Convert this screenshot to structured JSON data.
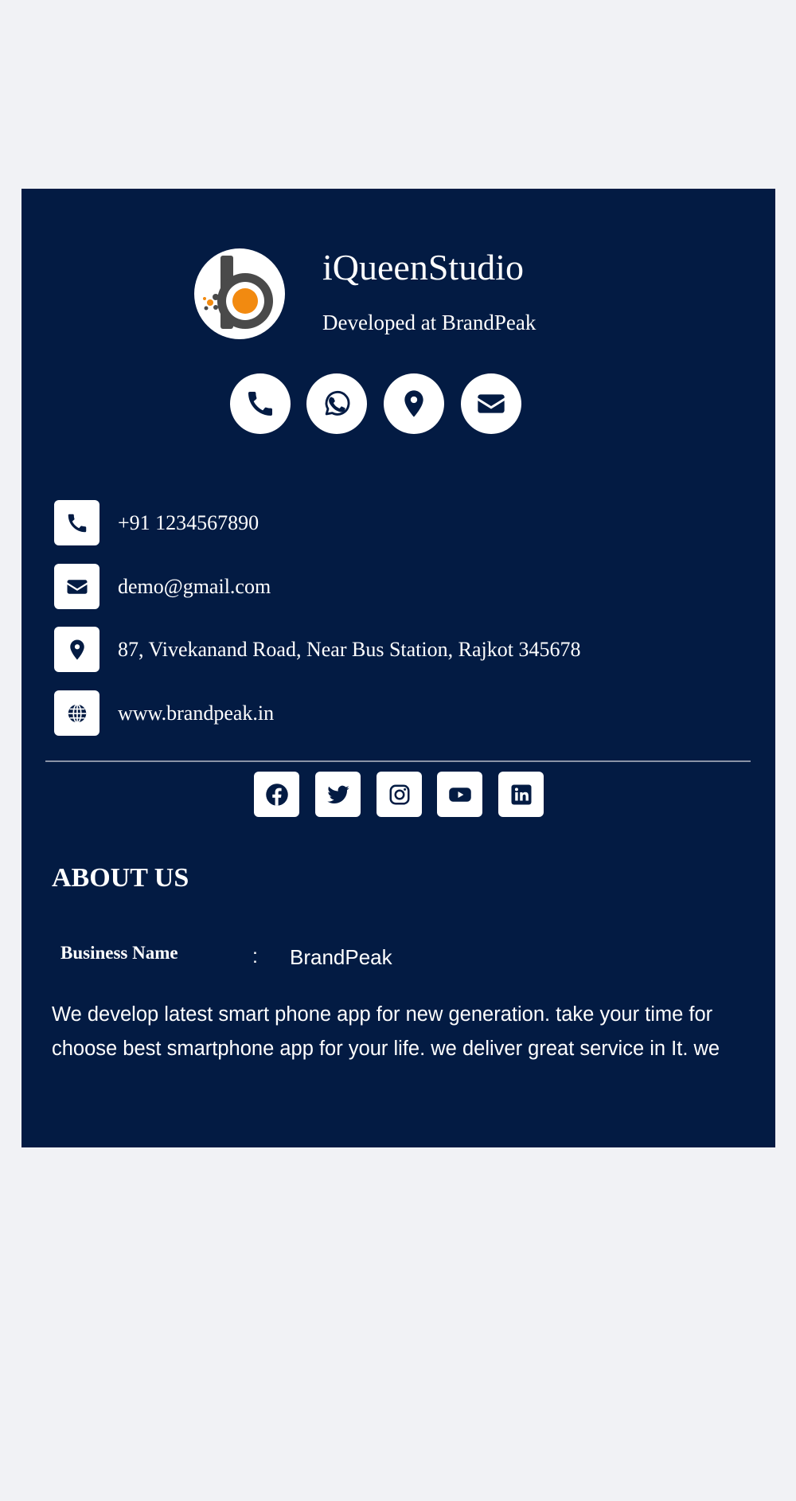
{
  "brand": {
    "name": "iQueenStudio",
    "tagline": "Developed at BrandPeak"
  },
  "quick_actions": [
    {
      "icon": "phone-icon"
    },
    {
      "icon": "whatsapp-icon"
    },
    {
      "icon": "location-pin-icon"
    },
    {
      "icon": "envelope-icon"
    }
  ],
  "contact": {
    "phone": "+91 1234567890",
    "email": "demo@gmail.com",
    "address": "87, Vivekanand Road, Near Bus Station, Rajkot 345678",
    "website": "www.brandpeak.in"
  },
  "social": [
    "facebook-icon",
    "twitter-icon",
    "instagram-icon",
    "youtube-icon",
    "linkedin-icon"
  ],
  "about": {
    "heading": "ABOUT US",
    "business_name_label": "Business Name",
    "separator": ":",
    "business_name_value": "BrandPeak",
    "description": "We develop latest smart phone app for new generation. take your time for choose best smartphone app for your life. we deliver great service in It. we"
  },
  "colors": {
    "page_background": "#f1f2f5",
    "card_background": "#031b43",
    "icon_foreground": "#031b43",
    "logo_accent": "#f28a10",
    "logo_dark": "#4a4a4a"
  }
}
